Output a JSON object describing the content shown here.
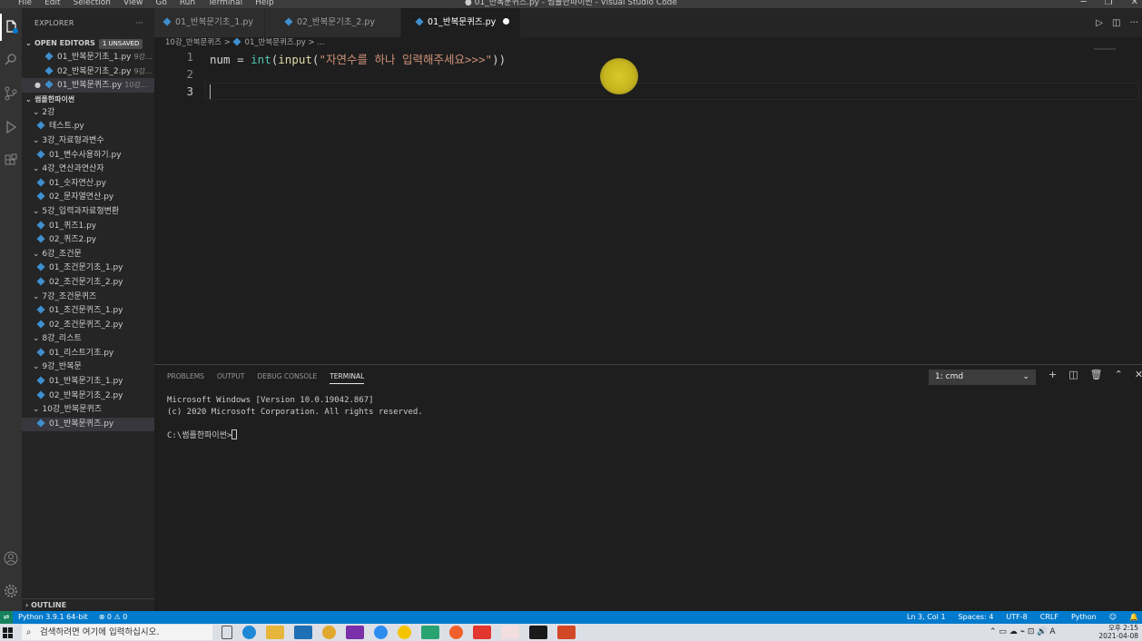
{
  "window": {
    "title": "● 01_반복문퀴즈.py - 썸플한파이썬 - Visual Studio Code",
    "menu": [
      "File",
      "Edit",
      "Selection",
      "View",
      "Go",
      "Run",
      "Terminal",
      "Help"
    ]
  },
  "sidebar": {
    "header": "EXPLORER",
    "open_editors": {
      "label": "OPEN EDITORS",
      "badge": "1 UNSAVED",
      "items": [
        {
          "name": "01_반복문기초_1.py",
          "hint": "9강..."
        },
        {
          "name": "02_반복문기초_2.py",
          "hint": "9강..."
        },
        {
          "name": "01_반복문퀴즈.py",
          "hint": "10강..."
        }
      ]
    },
    "project": {
      "label": "썸플한파이썬",
      "tree": [
        {
          "type": "folder",
          "name": "2강"
        },
        {
          "type": "file",
          "name": "테스트.py"
        },
        {
          "type": "folder",
          "name": "3강_자료형과변수"
        },
        {
          "type": "file",
          "name": "01_변수사용하기.py"
        },
        {
          "type": "folder",
          "name": "4강_연산과연산자"
        },
        {
          "type": "file",
          "name": "01_숫자연산.py"
        },
        {
          "type": "file",
          "name": "02_문자열연산.py"
        },
        {
          "type": "folder",
          "name": "5강_입력과자료형변환"
        },
        {
          "type": "file",
          "name": "01_퀴즈1.py"
        },
        {
          "type": "file",
          "name": "02_퀴즈2.py"
        },
        {
          "type": "folder",
          "name": "6강_조건문"
        },
        {
          "type": "file",
          "name": "01_조건문기초_1.py"
        },
        {
          "type": "file",
          "name": "02_조건문기초_2.py"
        },
        {
          "type": "folder",
          "name": "7강_조건문퀴즈"
        },
        {
          "type": "file",
          "name": "01_조건문퀴즈_1.py"
        },
        {
          "type": "file",
          "name": "02_조건문퀴즈_2.py"
        },
        {
          "type": "folder",
          "name": "8강_리스트"
        },
        {
          "type": "file",
          "name": "01_리스트기초.py"
        },
        {
          "type": "folder",
          "name": "9강_반복문"
        },
        {
          "type": "file",
          "name": "01_반복문기초_1.py"
        },
        {
          "type": "file",
          "name": "02_반복문기초_2.py"
        },
        {
          "type": "folder",
          "name": "10강_반복문퀴즈"
        },
        {
          "type": "file",
          "name": "01_반복문퀴즈.py"
        }
      ]
    },
    "outline": "OUTLINE"
  },
  "tabs": [
    {
      "label": "01_반복문기초_1.py"
    },
    {
      "label": "02_반복문기초_2.py"
    },
    {
      "label": "01_반복문퀴즈.py"
    }
  ],
  "breadcrumb": {
    "folder": "10강_반복문퀴즈",
    "sep": ">",
    "file": "01_반복문퀴즈.py",
    "tail": "> ..."
  },
  "editor": {
    "line_numbers": [
      "1",
      "2",
      "3"
    ],
    "code": {
      "var": "num",
      "eq": " = ",
      "fn1": "int",
      "p1": "(",
      "fn2": "input",
      "p2": "(",
      "str": "\"자연수를 하나 입력해주세요>>>\"",
      "p3": "))"
    }
  },
  "panel": {
    "tabs": [
      "PROBLEMS",
      "OUTPUT",
      "DEBUG CONSOLE",
      "TERMINAL"
    ],
    "terminal_select": "1: cmd",
    "terminal_lines": [
      "Microsoft Windows [Version 10.0.19042.867]",
      "(c) 2020 Microsoft Corporation. All rights reserved.",
      ""
    ],
    "prompt": "C:\\썸플한파이썬>"
  },
  "statusbar": {
    "python": "Python 3.9.1 64-bit",
    "problems": "⊗ 0 ⚠ 0",
    "position": "Ln 3, Col 1",
    "spaces": "Spaces: 4",
    "encoding": "UTF-8",
    "eol": "CRLF",
    "language": "Python"
  },
  "taskbar": {
    "search_placeholder": "검색하려면 여기에 입력하십시오.",
    "time": "오후 2:15",
    "date": "2021-04-08",
    "ime": "A"
  },
  "colors": {
    "accent": "#007acc",
    "keyword_fn": "#4ec9b0",
    "string": "#ce9178",
    "pointer": "#d9c82a"
  }
}
